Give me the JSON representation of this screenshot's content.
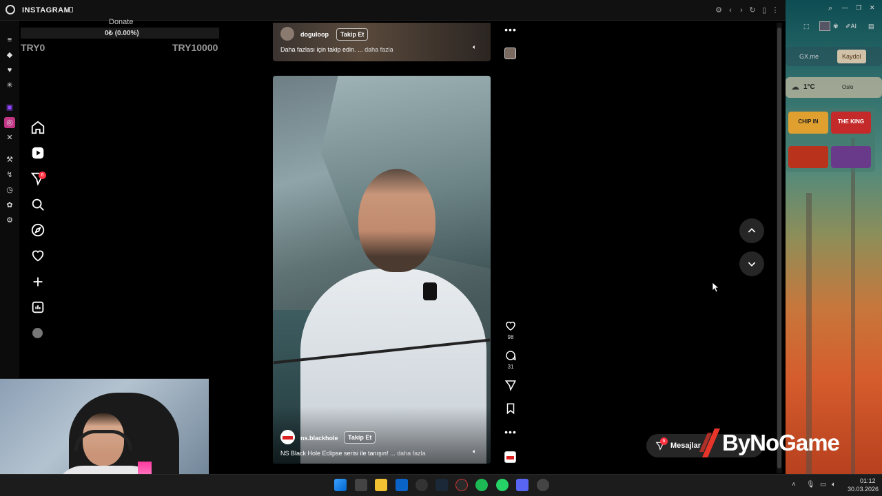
{
  "window": {
    "title": "INSTAGRAM"
  },
  "donate": {
    "label": "Donate",
    "progress_text": "0₺ (0.00%)",
    "min": "TRY0",
    "max": "TRY10000",
    "progress": 0
  },
  "nav": {
    "items": [
      {
        "name": "home-icon"
      },
      {
        "name": "reels-icon"
      },
      {
        "name": "messages-icon",
        "badge": "6"
      },
      {
        "name": "search-icon"
      },
      {
        "name": "explore-icon"
      },
      {
        "name": "notifications-icon"
      },
      {
        "name": "create-icon"
      },
      {
        "name": "dashboard-icon"
      },
      {
        "name": "profile-avatar"
      }
    ]
  },
  "posts": [
    {
      "username": "doguloop",
      "follow": "Takip Et",
      "caption": "Daha fazlası için takip edin.",
      "ellipsis": " ...",
      "more": " daha fazla"
    },
    {
      "username": "ns.blackhole",
      "follow": "Takip Et",
      "caption": "NS Black Hole Eclipse serisi ile tanışın!",
      "ellipsis": " ...",
      "more": " daha fazla"
    }
  ],
  "actions": {
    "likes": "98",
    "comments": "31"
  },
  "messages": {
    "label": "Mesajlar",
    "badge": "6"
  },
  "right_panel": {
    "gxme": "GX.me",
    "register": "Kaydol",
    "weather_temp": "1°C",
    "weather_city": "Oslo",
    "ai": "AI"
  },
  "games": [
    "CHIP IN",
    "THE KING",
    "",
    ""
  ],
  "brand": "ByNoGame",
  "clock": {
    "time": "01:12",
    "date": "30.03.2026"
  },
  "colors": {
    "accent": "#c13584",
    "badge": "#ff3040"
  }
}
